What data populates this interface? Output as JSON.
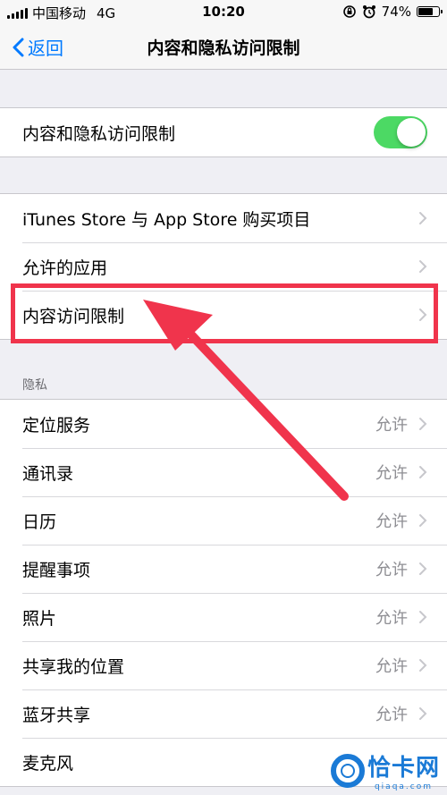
{
  "status_bar": {
    "carrier": "中国移动",
    "network": "4G",
    "time": "10:20",
    "battery": "74%",
    "battery_level": 0.74
  },
  "nav": {
    "back_label": "返回",
    "title": "内容和隐私访问限制"
  },
  "master_toggle": {
    "label": "内容和隐私访问限制",
    "on": true
  },
  "store_group": {
    "items": [
      {
        "label": "iTunes Store 与 App Store 购买项目"
      },
      {
        "label": "允许的应用"
      },
      {
        "label": "内容访问限制"
      }
    ]
  },
  "privacy_group": {
    "header": "隐私",
    "items": [
      {
        "label": "定位服务",
        "value": "允许"
      },
      {
        "label": "通讯录",
        "value": "允许"
      },
      {
        "label": "日历",
        "value": "允许"
      },
      {
        "label": "提醒事项",
        "value": "允许"
      },
      {
        "label": "照片",
        "value": "允许"
      },
      {
        "label": "共享我的位置",
        "value": "允许"
      },
      {
        "label": "蓝牙共享",
        "value": "允许"
      },
      {
        "label": "麦克风",
        "value": ""
      }
    ]
  },
  "watermark": {
    "name": "恰卡网",
    "url": "qiaqa.com"
  },
  "colors": {
    "accent": "#007aff",
    "toggle_on": "#4cd964",
    "annotation": "#f0344c",
    "background": "#efeff4"
  }
}
